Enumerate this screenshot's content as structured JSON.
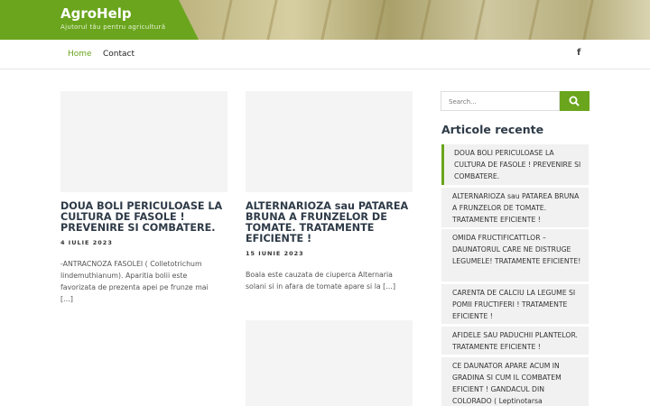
{
  "site": {
    "title": "AgroHelp",
    "tagline": "Ajutorul tău pentru agricultură"
  },
  "nav": {
    "items": [
      "Home",
      "Contact"
    ],
    "social_icon": "f"
  },
  "posts": [
    {
      "title": "DOUA BOLI PERICULOASE LA CULTURA DE FASOLE ! PREVENIRE SI COMBATERE.",
      "date": "4 IULIE 2023",
      "excerpt": "-ANTRACNOZA FASOLEI ( Colletotrichum lindemuthianum). Aparitia bolii este favorizata de prezenta apei pe frunze mai […]"
    },
    {
      "title": "ALTERNARIOZA sau PATAREA BRUNA A FRUNZELOR DE TOMATE. TRATAMENTE EFICIENTE !",
      "date": "15 IUNIE 2023",
      "excerpt": "Boala este cauzata de ciuperca Alternaria solani si in afara de tomate apare si la […]"
    }
  ],
  "search": {
    "placeholder": "Search..."
  },
  "recent": {
    "title": "Articole recente",
    "items": [
      "DOUA BOLI PERICULOASE LA CULTURA DE FASOLE ! PREVENIRE SI COMBATERE.",
      "ALTERNARIOZA sau PATAREA BRUNA A FRUNZELOR DE TOMATE. TRATAMENTE EFICIENTE !",
      "OMIDA FRUCTIFICATTLOR – DAUNATORUL CARE NE DISTRUGE LEGUMELE! TRATAMENTE EFICIENTE!",
      "CARENTA DE CALCIU LA LEGUME SI POMII FRUCTIFERI ! TRATAMENTE EFICIENTE !",
      "AFIDELE SAU PADUCHII PLANTELOR. TRATAMENTE EFICIENTE !",
      "CE DAUNATOR APARE ACUM IN GRADINA SI CUM IL COMBATEM EFICIENT ! GANDACUL DIN COLORADO ( Leptinotarsa"
    ]
  },
  "colors": {
    "accent": "#6aa51d",
    "title_dark": "#2e3a47"
  }
}
